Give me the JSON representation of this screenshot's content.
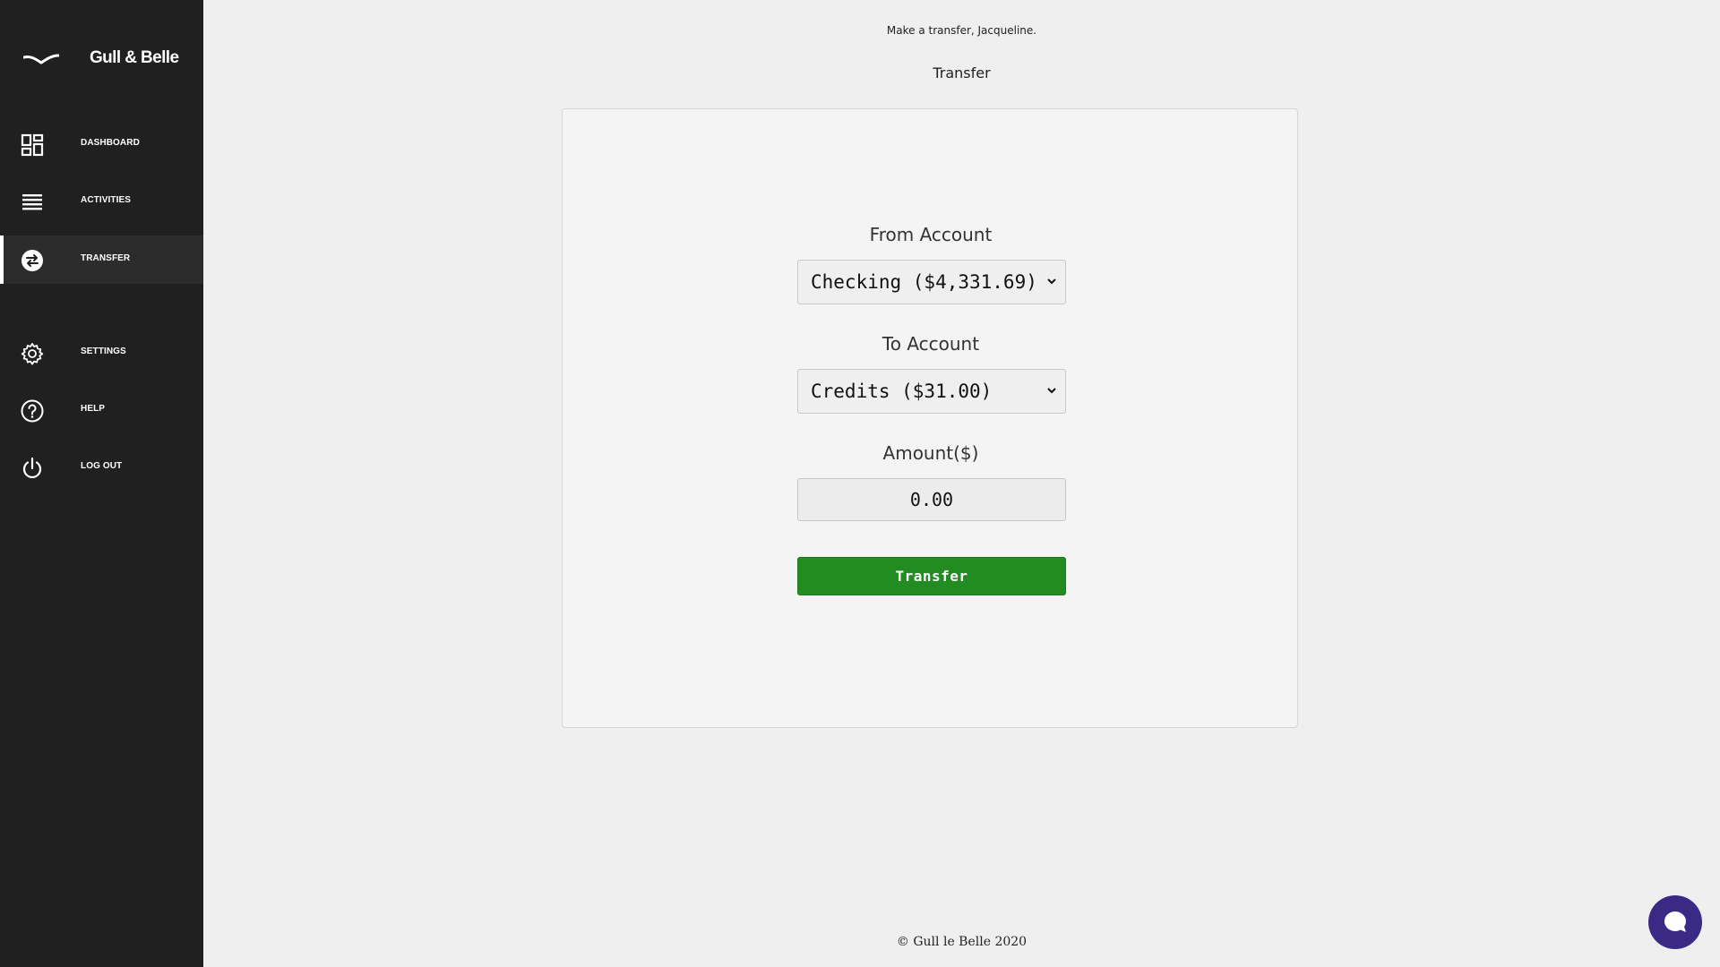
{
  "brand": {
    "name": "Gull & Belle",
    "logo_icon": "gull-logo-icon"
  },
  "sidebar": {
    "items": [
      {
        "label": "DASHBOARD",
        "icon": "dashboard-icon",
        "active": false
      },
      {
        "label": "ACTIVITIES",
        "icon": "list-icon",
        "active": false
      },
      {
        "label": "TRANSFER",
        "icon": "transfer-icon",
        "active": true
      },
      {
        "label": "SETTINGS",
        "icon": "gear-icon",
        "active": false
      },
      {
        "label": "HELP",
        "icon": "help-icon",
        "active": false
      },
      {
        "label": "LOG OUT",
        "icon": "power-icon",
        "active": false
      }
    ]
  },
  "header": {
    "greeting": "Make a transfer, Jacqueline.",
    "title": "Transfer"
  },
  "form": {
    "from_label": "From Account",
    "from_value": "Checking ($4,331.69)",
    "to_label": "To Account",
    "to_value": "Credits ($31.00)",
    "amount_label": "Amount($)",
    "amount_value": "0.00",
    "submit_label": "Transfer"
  },
  "footer": {
    "text": "© Gull le Belle 2020"
  },
  "colors": {
    "sidebar_bg": "#202020",
    "page_bg": "#efefef",
    "button_green": "#228b22",
    "chat_purple": "#3a2a86"
  },
  "chat": {
    "icon": "chat-icon"
  }
}
